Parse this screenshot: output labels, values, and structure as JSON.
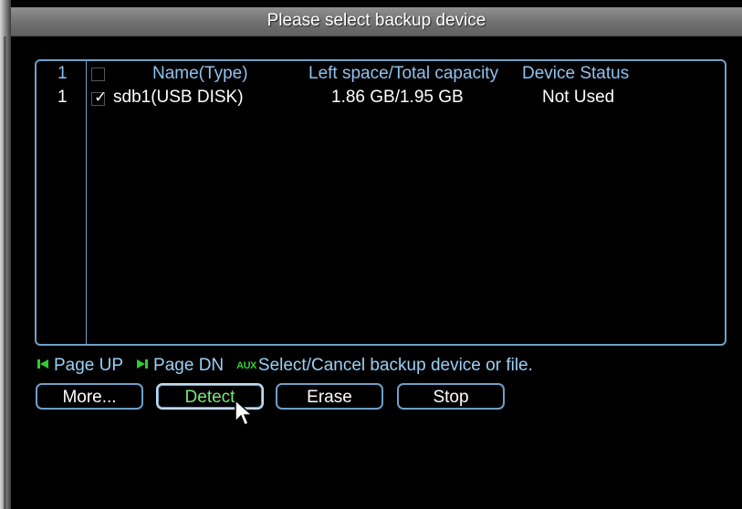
{
  "window": {
    "title": "Please select backup device"
  },
  "table": {
    "header": {
      "index": "1",
      "name": "Name(Type)",
      "space": "Left space/Total capacity",
      "status": "Device Status"
    },
    "rows": [
      {
        "index": "1",
        "checked": true,
        "name": "sdb1(USB DISK)",
        "space": "1.86 GB/1.95 GB",
        "status": "Not Used"
      }
    ]
  },
  "hints": {
    "page_up_label": "Page UP",
    "page_down_label": "Page DN",
    "aux_label": "AUX",
    "aux_text": "Select/Cancel backup device or file."
  },
  "buttons": {
    "more": "More...",
    "detect": "Detect",
    "erase": "Erase",
    "stop": "Stop"
  },
  "colors": {
    "accent_border": "#6fa0c8",
    "header_text": "#8fc2ee",
    "active_button_text": "#7ce67c",
    "hint_icon_green": "#33cc33"
  },
  "icons": {
    "page_up": "skip-back-icon",
    "page_down": "skip-forward-icon",
    "cursor": "mouse-pointer-icon"
  }
}
